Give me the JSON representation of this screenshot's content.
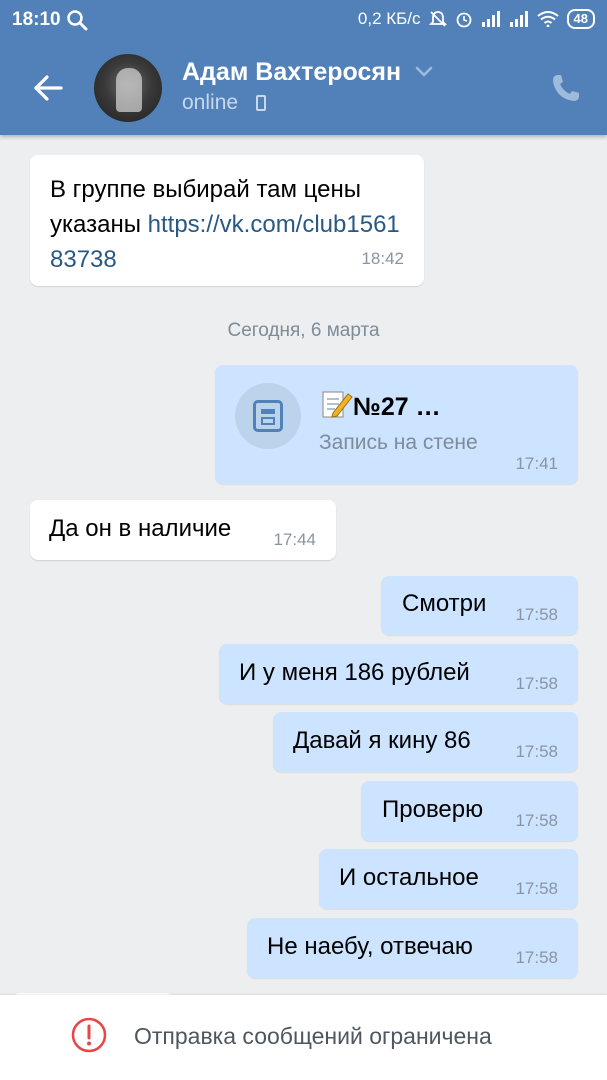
{
  "status_bar": {
    "time": "18:10",
    "network_speed": "0,2 КБ/с",
    "battery": "48",
    "icons": [
      "search-icon",
      "mute-icon",
      "alarm-icon",
      "signal-icon",
      "signal-icon",
      "wifi-icon",
      "battery-icon"
    ]
  },
  "header": {
    "contact_name": "Адам Вахтеросян",
    "status": "online",
    "bg_color": "#5181b8"
  },
  "messages": [
    {
      "side": "in",
      "text": "В группе выбирай там цены указаны ",
      "link": "https://vk.com/club156183738",
      "time": "18:42"
    },
    {
      "type": "date",
      "text": "Сегодня, 6 марта"
    },
    {
      "side": "out",
      "type": "wall",
      "title": "№27 …",
      "subtitle": "Запись на стене",
      "time": "17:41"
    },
    {
      "side": "in",
      "text": "Да он в наличие",
      "time": "17:44"
    },
    {
      "side": "out",
      "text": "Смотри",
      "time": "17:58"
    },
    {
      "side": "out",
      "text": "И у меня 186 рублей",
      "time": "17:58"
    },
    {
      "side": "out",
      "text": "Давай я кину 86",
      "time": "17:58"
    },
    {
      "side": "out",
      "text": "Проверю",
      "time": "17:58"
    },
    {
      "side": "out",
      "text": "И остальное",
      "time": "17:58"
    },
    {
      "side": "out",
      "text": "Не наебу, отвечаю",
      "time": "17:58"
    }
  ],
  "bottom_bar": {
    "restriction_text": "Отправка сообщений ограничена",
    "warn_color": "#e64646"
  }
}
